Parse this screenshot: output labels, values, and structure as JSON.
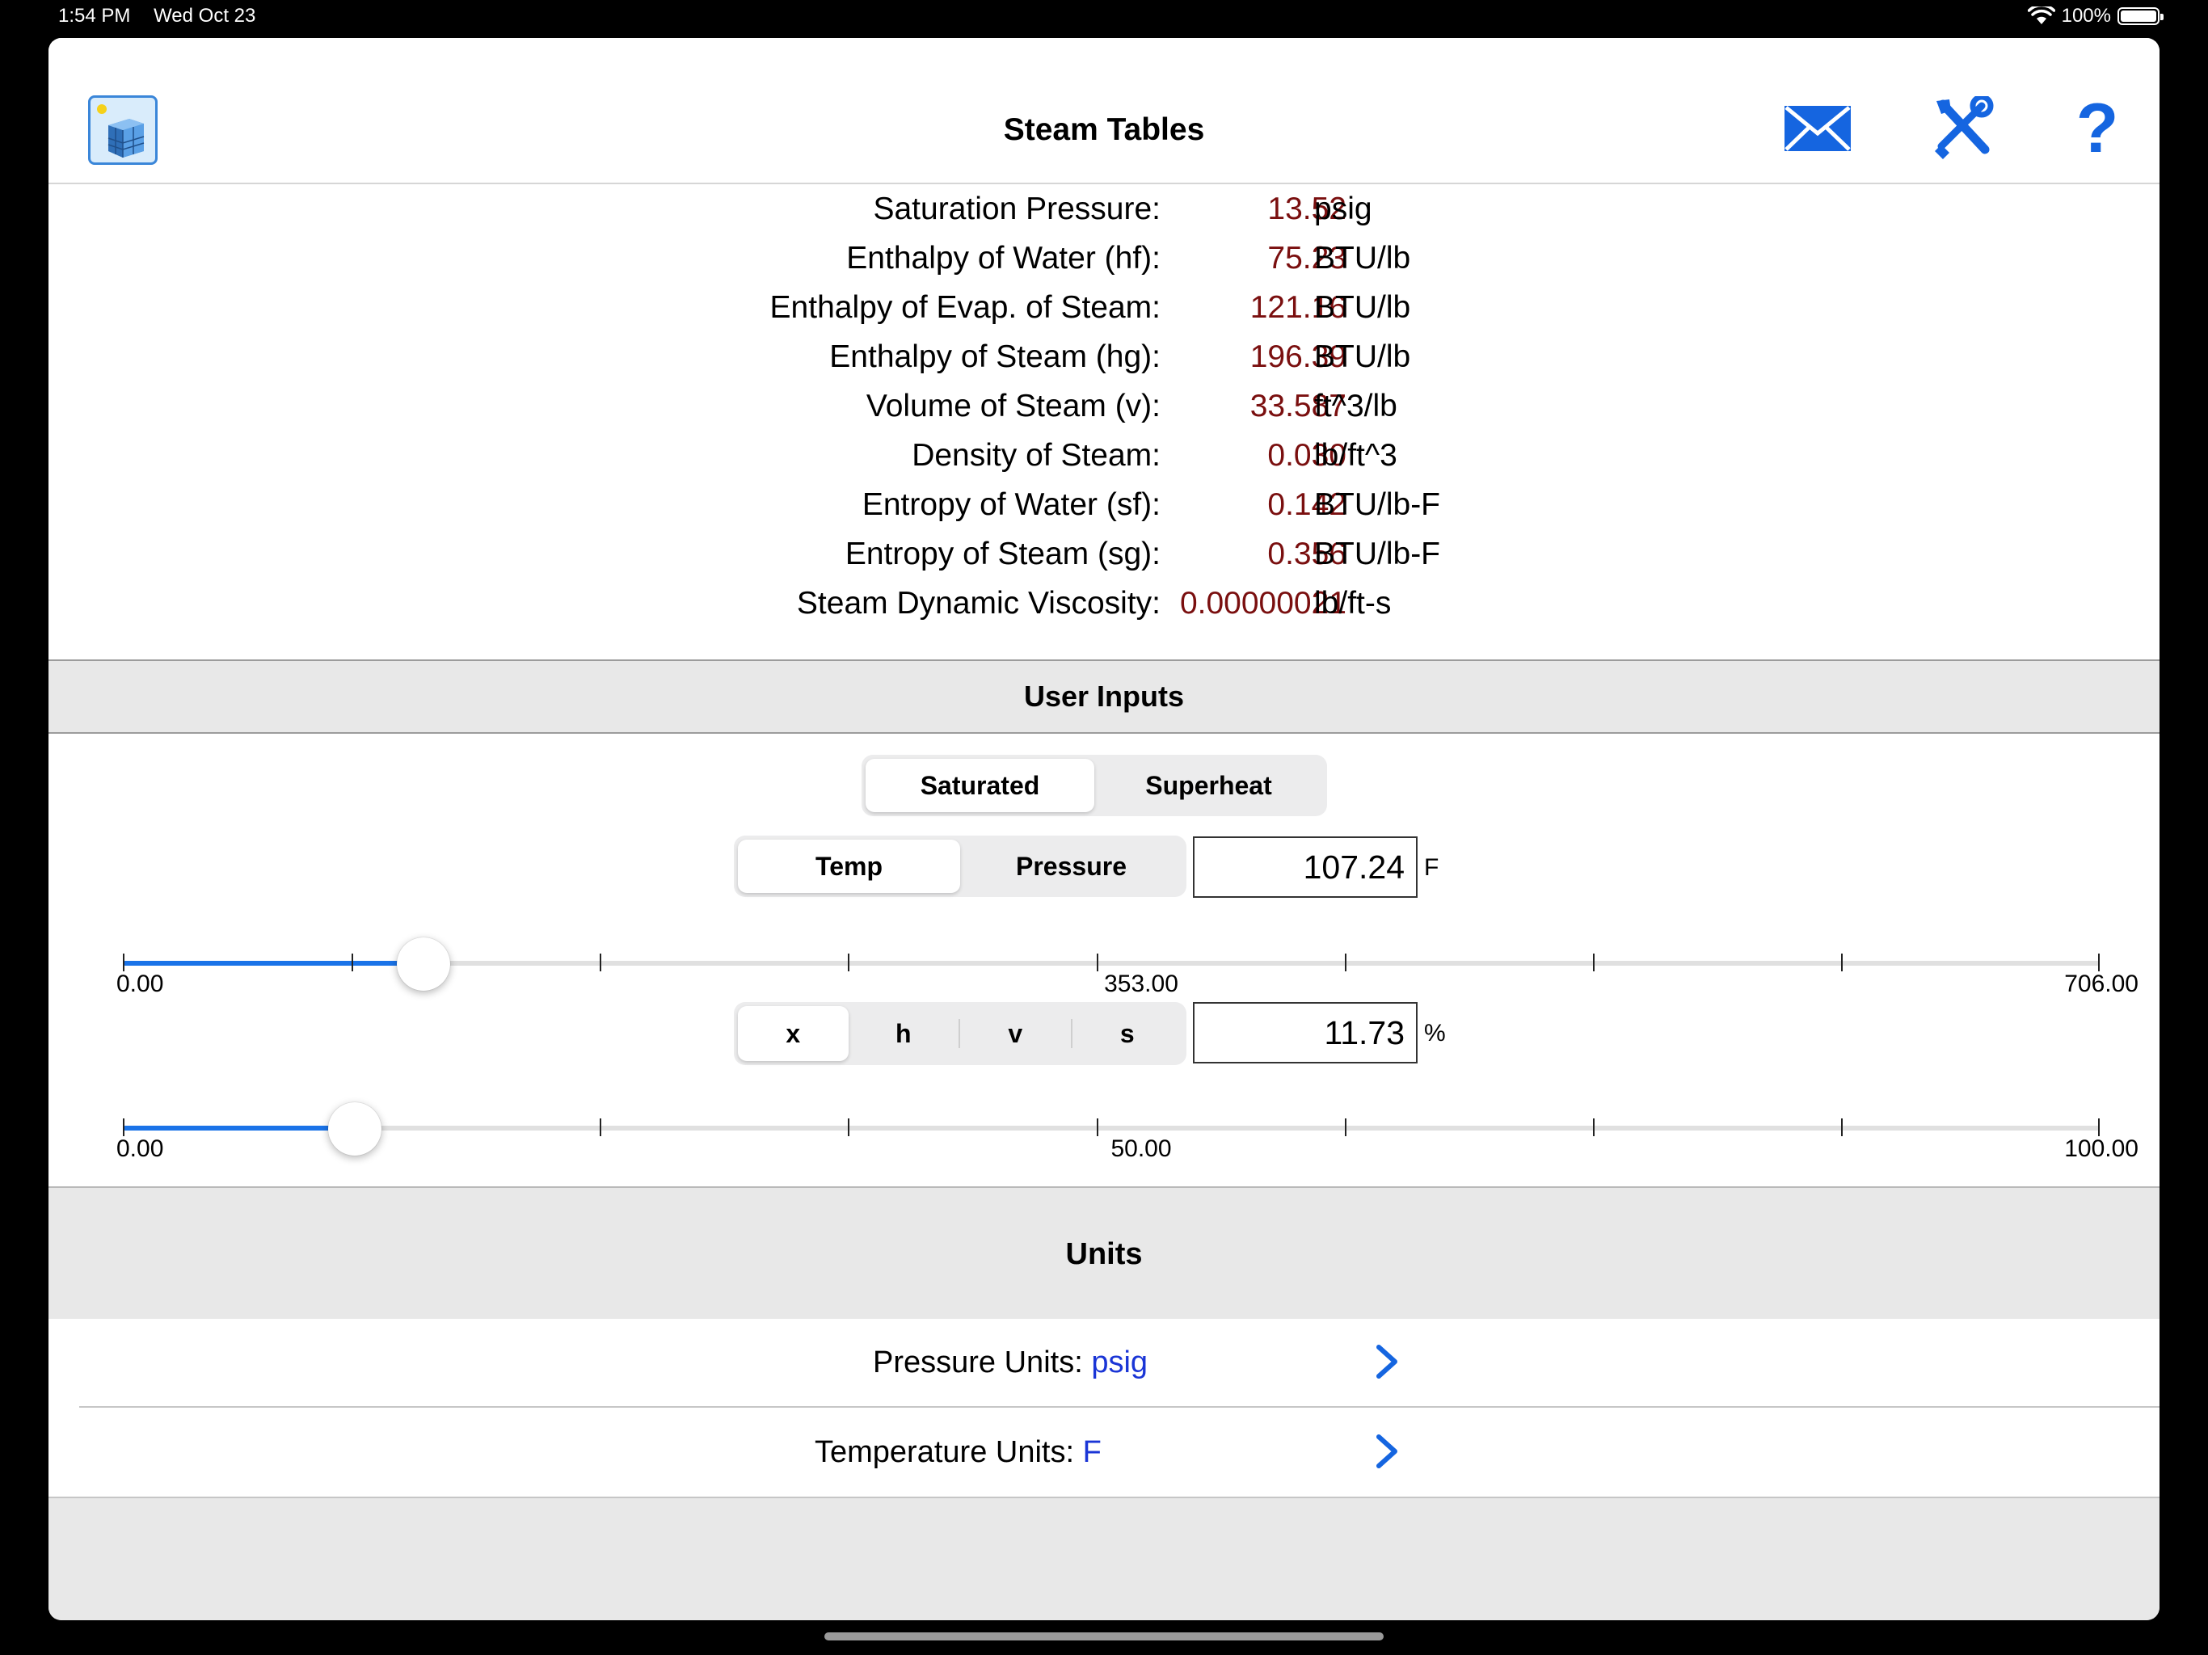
{
  "status_bar": {
    "time": "1:54 PM",
    "date": "Wed Oct 23",
    "battery": "100%",
    "battery_level": 1.0
  },
  "header": {
    "title": "Steam Tables",
    "icons": {
      "app": "app-logo-icon",
      "mail": "mail-icon",
      "tools": "tools-icon",
      "help": "help-icon"
    },
    "help_glyph": "?"
  },
  "results": [
    {
      "label": "Saturation Pressure:",
      "value": "13.52",
      "unit": "psig"
    },
    {
      "label": "Enthalpy of Water (hf):",
      "value": "75.23",
      "unit": "BTU/lb"
    },
    {
      "label": "Enthalpy of Evap. of Steam:",
      "value": "121.16",
      "unit": "BTU/lb"
    },
    {
      "label": "Enthalpy of Steam (hg):",
      "value": "196.39",
      "unit": "BTU/lb"
    },
    {
      "label": "Volume of Steam (v):",
      "value": "33.587",
      "unit": "ft^3/lb"
    },
    {
      "label": "Density of Steam:",
      "value": "0.030",
      "unit": "lb/ft^3"
    },
    {
      "label": "Entropy of Water (sf):",
      "value": "0.142",
      "unit": "BTU/lb-F"
    },
    {
      "label": "Entropy of Steam (sg):",
      "value": "0.356",
      "unit": "BTU/lb-F"
    },
    {
      "label": "Steam Dynamic Viscosity:",
      "value": "0.00000021",
      "unit": "lb/ft-s"
    }
  ],
  "user_inputs": {
    "title": "User Inputs",
    "mode_segment": {
      "options": [
        "Saturated",
        "Superheat"
      ],
      "selected": "Saturated"
    },
    "temp_segment": {
      "options": [
        "Temp",
        "Pressure"
      ],
      "selected": "Temp"
    },
    "temp_input": {
      "value": "107.24",
      "unit": "F"
    },
    "temp_slider": {
      "min": 0,
      "max": 706,
      "value": 107.24,
      "min_label": "0.00",
      "mid_label": "353.00",
      "max_label": "706.00"
    },
    "property_segment": {
      "options": [
        "x",
        "h",
        "v",
        "s"
      ],
      "selected": "x"
    },
    "quality_input": {
      "value": "11.73",
      "unit": "%"
    },
    "quality_slider": {
      "min": 0,
      "max": 100,
      "value": 11.73,
      "min_label": "0.00",
      "mid_label": "50.00",
      "max_label": "100.00"
    }
  },
  "units": {
    "title": "Units",
    "pressure": {
      "label": "Pressure Units:",
      "value": "psig"
    },
    "temperature": {
      "label": "Temperature Units:",
      "value": "F"
    }
  },
  "colors": {
    "accent": "#1a73e8",
    "result_value": "#7a0f0f",
    "unit_value": "#1a35d6",
    "section_bg": "#e8e8e8"
  }
}
